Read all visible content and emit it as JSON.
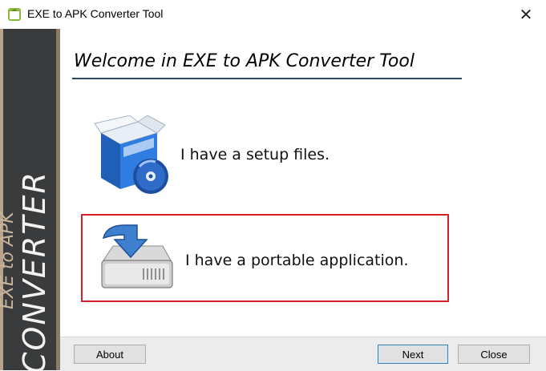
{
  "window": {
    "title": "EXE to APK Converter Tool",
    "close_glyph": "✕"
  },
  "sidebar": {
    "line1": "EXE to APK",
    "line2": "CONVERTER"
  },
  "main": {
    "heading": "Welcome in EXE to APK Converter Tool",
    "options": [
      {
        "label": "I have a setup files.",
        "icon": "software-box-icon",
        "selected": false
      },
      {
        "label": "I have a portable application.",
        "icon": "drive-download-icon",
        "selected": true
      }
    ]
  },
  "footer": {
    "about_label": "About",
    "next_label": "Next",
    "close_label": "Close"
  },
  "colors": {
    "sidebar_bg": "#3a3b3d",
    "sidebar_accent": "#c9b59a",
    "selection_border": "#d4202b",
    "heading_rule": "#2a4a68"
  }
}
